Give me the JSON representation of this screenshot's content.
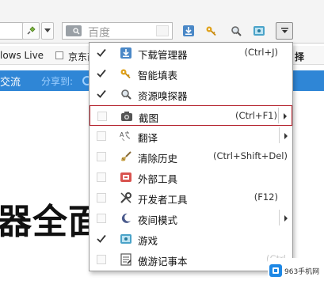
{
  "toolbar": {
    "search_placeholder": "百度"
  },
  "bookmarks": {
    "items": [
      "lows Live",
      "京东商"
    ],
    "extra_text": "择"
  },
  "page": {
    "nav_exchange": "交流",
    "nav_share": "分享到:",
    "headline": "器全面"
  },
  "menu": {
    "items": [
      {
        "label": "下载管理器",
        "shortcut": "(Ctrl+J)",
        "checked": true,
        "icon": "download-icon"
      },
      {
        "label": "智能填表",
        "shortcut": "",
        "checked": true,
        "icon": "key-icon"
      },
      {
        "label": "资源嗅探器",
        "shortcut": "",
        "checked": true,
        "icon": "sniffer-icon"
      },
      {
        "label": "截图",
        "shortcut": "(Ctrl+F1)",
        "checked": false,
        "icon": "camera-icon",
        "submenu": true,
        "highlighted": true
      },
      {
        "label": "翻译",
        "shortcut": "",
        "checked": false,
        "icon": "translate-icon",
        "submenu": true
      },
      {
        "label": "清除历史",
        "shortcut": "(Ctrl+Shift+Del)",
        "checked": false,
        "icon": "broom-icon"
      },
      {
        "label": "外部工具",
        "shortcut": "",
        "checked": false,
        "icon": "external-tools-icon"
      },
      {
        "label": "开发者工具",
        "shortcut": "(F12)",
        "checked": false,
        "icon": "wrench-icon"
      },
      {
        "label": "夜间模式",
        "shortcut": "",
        "checked": false,
        "icon": "moon-icon",
        "submenu": true
      },
      {
        "label": "游戏",
        "shortcut": "",
        "checked": true,
        "icon": "game-icon"
      },
      {
        "label": "傲游记事本",
        "shortcut": "(Ctrl",
        "checked": false,
        "icon": "notepad-icon"
      }
    ]
  },
  "watermark": {
    "text": "963手机网"
  },
  "colors": {
    "highlight_border": "#b5242f",
    "nav_blue": "#2f86d6"
  }
}
